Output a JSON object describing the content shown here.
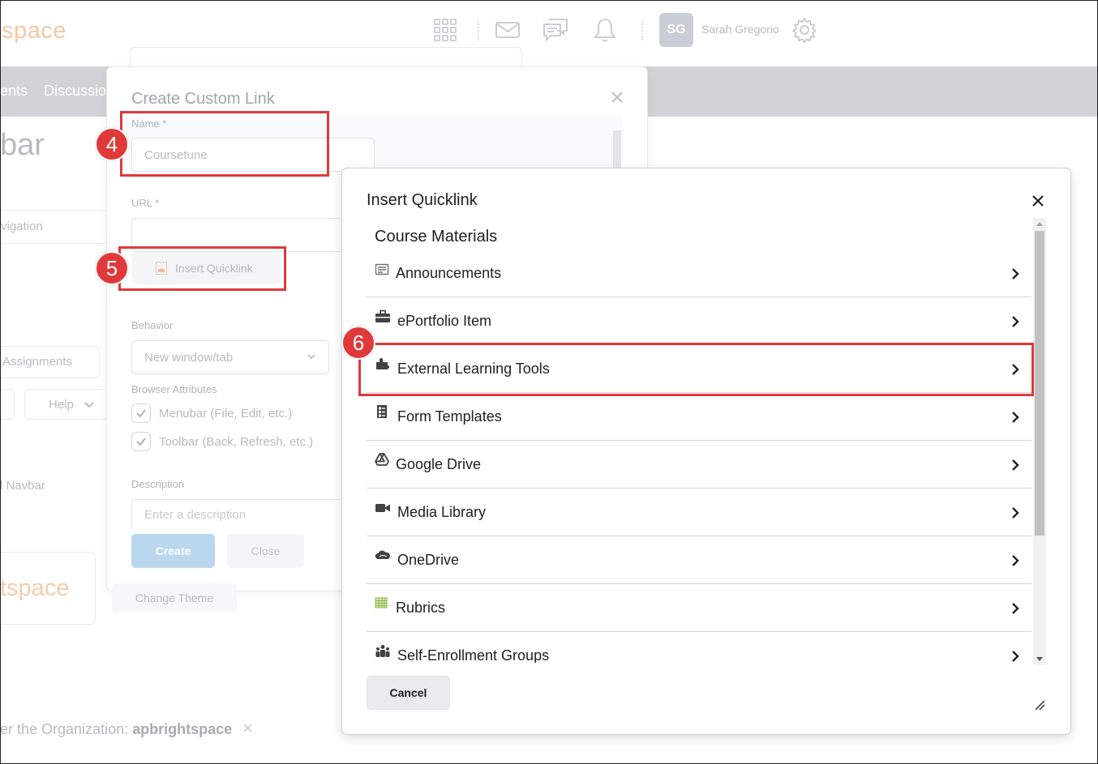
{
  "topbar": {
    "logo_fragment": "space",
    "icons": [
      "apps-grid-icon",
      "mail-icon",
      "chat-icon",
      "bell-icon",
      "gear-icon"
    ],
    "avatar_initials": "SG",
    "user_name": "Sarah Gregorio"
  },
  "navbar": {
    "items": [
      "ents",
      "Discussio"
    ]
  },
  "background": {
    "heading": "bar",
    "nav_field": "vigation",
    "assignments_label": "Assignments",
    "help_label": "Help",
    "navbar_label": "l Navbar",
    "logo_large": "tspace",
    "change_theme_label": "Change Theme",
    "org_prefix": "er the Organization: ",
    "org_name": "apbrightspace",
    "org_close": "×"
  },
  "create_custom_link": {
    "title": "Create Custom Link",
    "name_label": "Name *",
    "name_value": "Coursetune",
    "url_label": "URL *",
    "url_value": "",
    "insert_quicklink_label": "Insert Quicklink",
    "behavior_label": "Behavior",
    "behavior_value": "New window/tab",
    "browser_attributes_label": "Browser Attributes",
    "checkboxes": [
      {
        "label": "Menubar (File, Edit, etc.)",
        "checked": true
      },
      {
        "label": "Toolbar (Back, Refresh, etc.)",
        "checked": true
      }
    ],
    "description_label": "Description",
    "description_placeholder": "Enter a description",
    "create_label": "Create",
    "close_label": "Close"
  },
  "insert_quicklink": {
    "title": "Insert Quicklink",
    "section": "Course Materials",
    "items": [
      {
        "label": "Announcements",
        "icon": "announcements-icon"
      },
      {
        "label": "ePortfolio Item",
        "icon": "briefcase-icon"
      },
      {
        "label": "External Learning Tools",
        "icon": "puzzle-piece-icon"
      },
      {
        "label": "Form Templates",
        "icon": "form-template-icon"
      },
      {
        "label": "Google Drive",
        "icon": "google-drive-icon"
      },
      {
        "label": "Media Library",
        "icon": "video-camera-icon"
      },
      {
        "label": "OneDrive",
        "icon": "cloud-icon"
      },
      {
        "label": "Rubrics",
        "icon": "rubric-grid-icon"
      },
      {
        "label": "Self-Enrollment Groups",
        "icon": "groups-icon"
      }
    ],
    "cancel_label": "Cancel"
  },
  "callouts": [
    {
      "number": "4",
      "target": "name-field"
    },
    {
      "number": "5",
      "target": "insert-quicklink-button"
    },
    {
      "number": "6",
      "target": "external-learning-tools-item"
    }
  ],
  "colors": {
    "callout": "#e0393a",
    "primary_disabled": "#b9d7ee",
    "brand_faded": "#f6c7a3"
  }
}
